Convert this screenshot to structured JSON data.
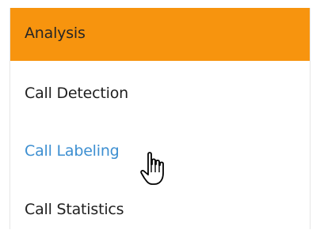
{
  "menu": {
    "header": "Analysis",
    "items": [
      {
        "label": "Call Detection",
        "state": "normal"
      },
      {
        "label": "Call Labeling",
        "state": "hover"
      },
      {
        "label": "Call Statistics",
        "state": "normal"
      }
    ]
  },
  "colors": {
    "header_bg": "#f7940e",
    "hover_text": "#3d8fd1",
    "text": "#1f1f1f"
  },
  "cursor": {
    "icon": "hand-pointer-icon"
  }
}
